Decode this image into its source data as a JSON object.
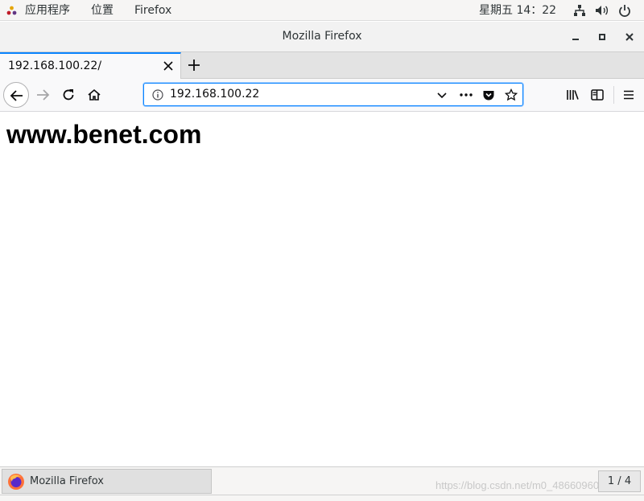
{
  "topbar": {
    "apps_menu": "应用程序",
    "places_menu": "位置",
    "active_app": "Firefox",
    "clock": "星期五 14：22"
  },
  "window": {
    "title": "Mozilla Firefox"
  },
  "tabs": [
    {
      "title": "192.168.100.22/"
    }
  ],
  "navbar": {
    "url": "192.168.100.22"
  },
  "page": {
    "heading": "www.benet.com"
  },
  "taskbar": {
    "window_label": "Mozilla Firefox",
    "workspace_pager": "1 / 4",
    "watermark": "https://blog.csdn.net/m0_48660960"
  },
  "colors": {
    "accent": "#0a84ff"
  }
}
